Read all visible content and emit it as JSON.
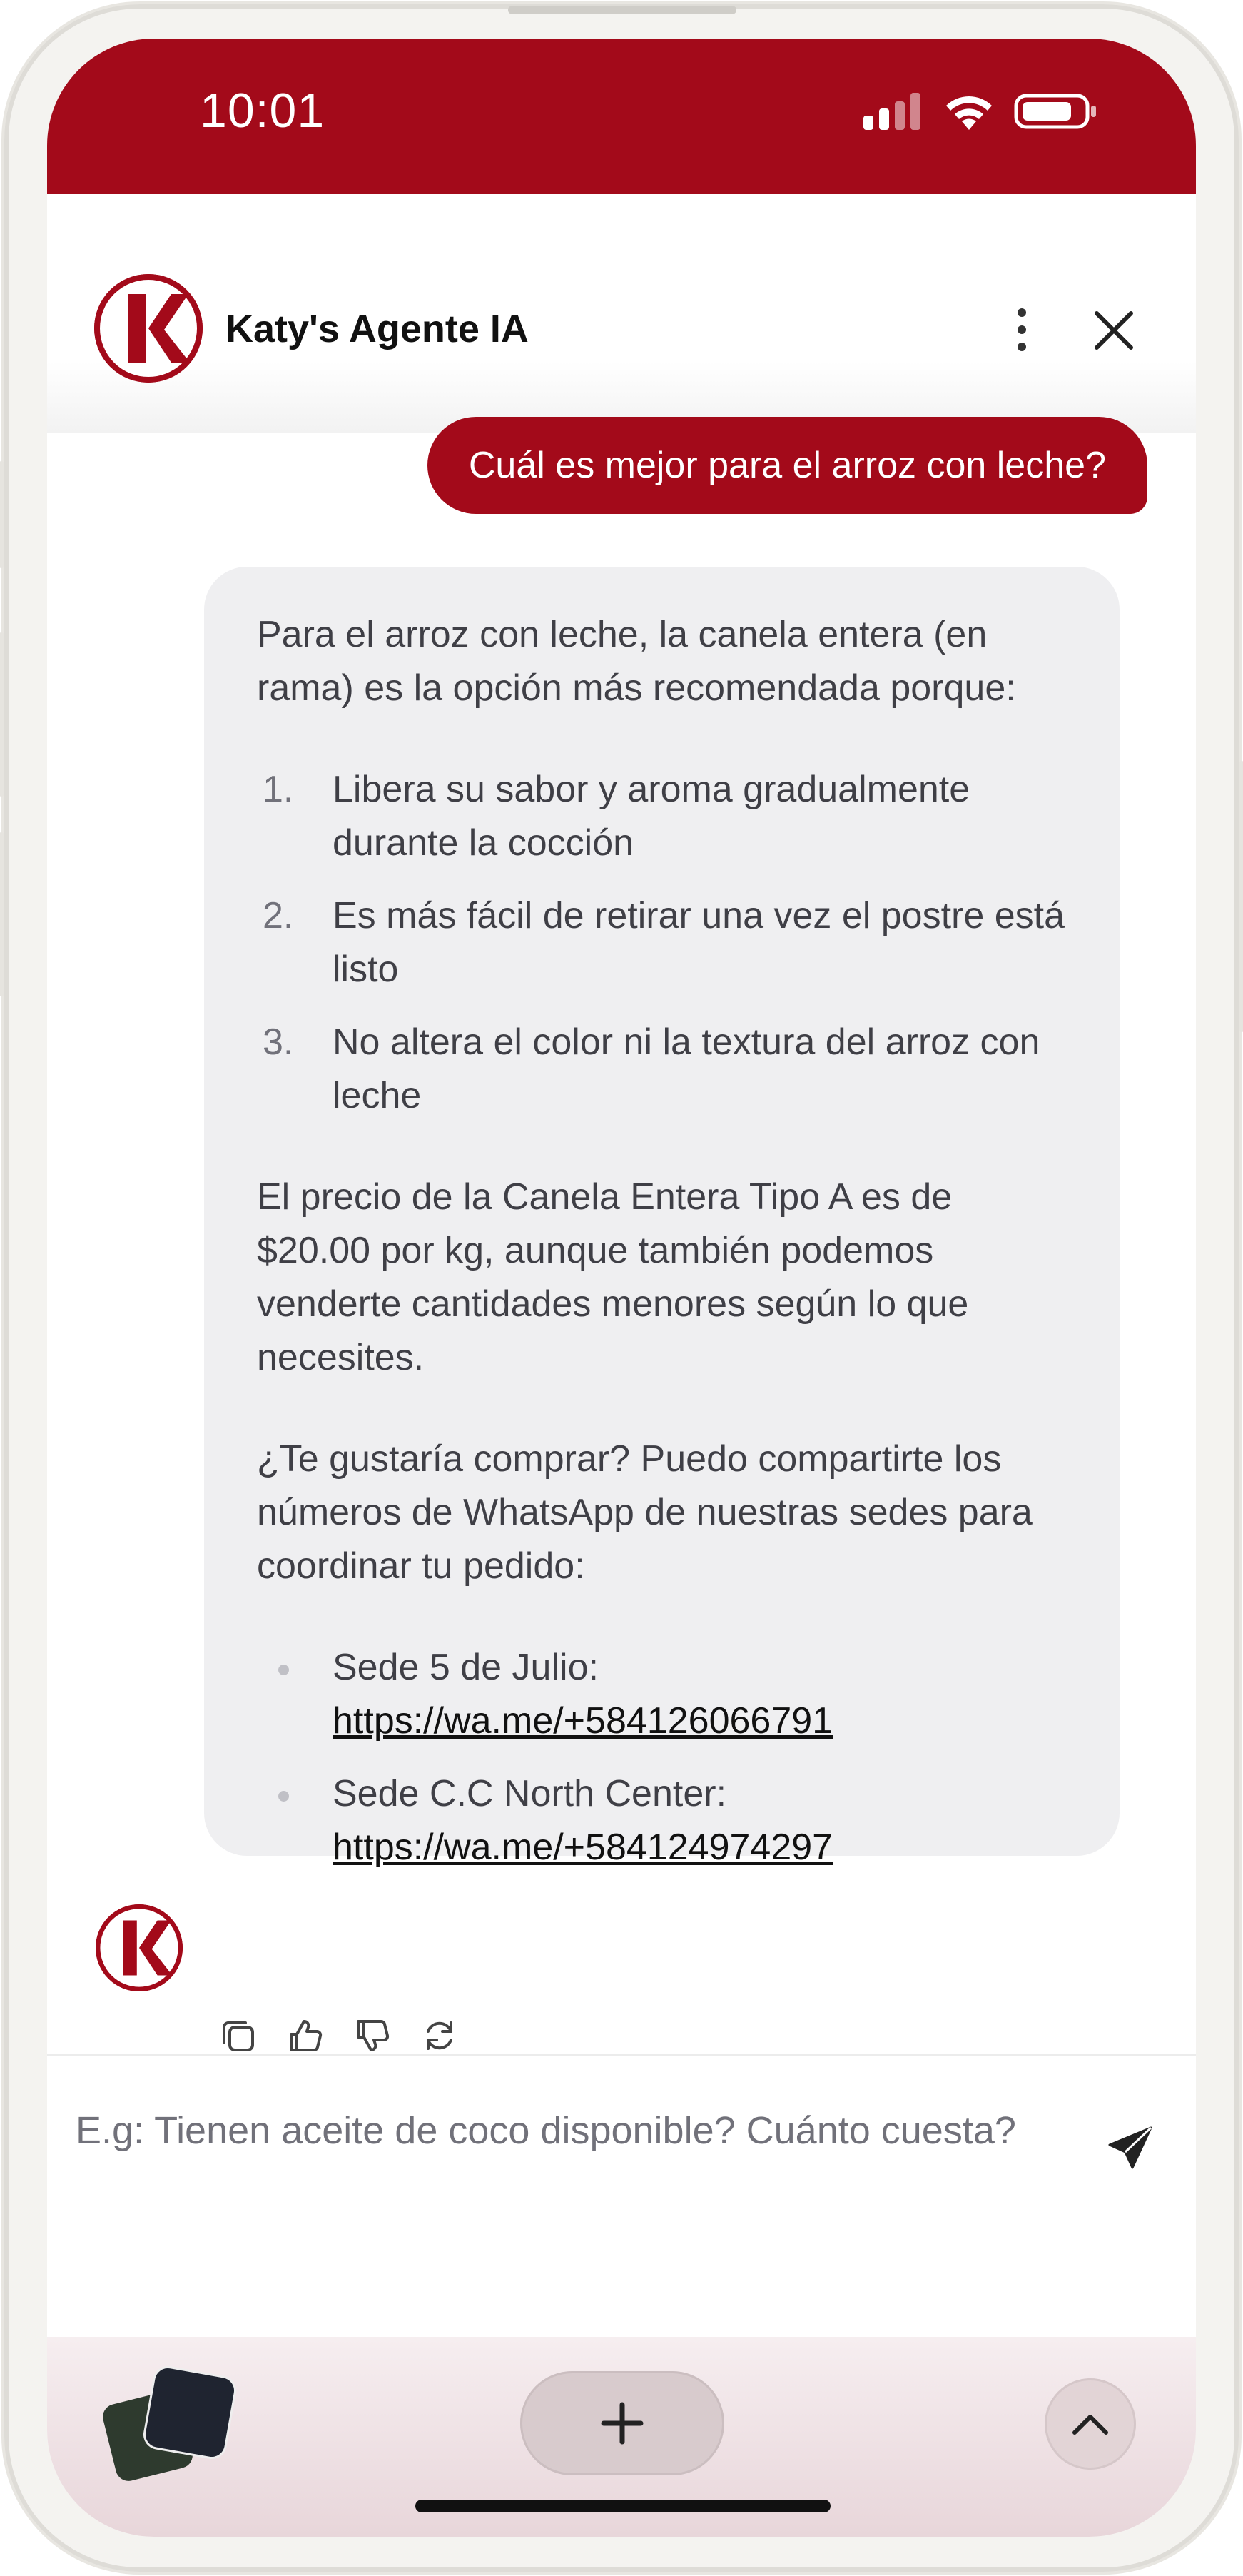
{
  "status_bar": {
    "time": "10:01"
  },
  "header": {
    "title": "Katy's Agente IA",
    "logo_letter": "K"
  },
  "chat": {
    "user_message": "Cuál es mejor para el arroz con leche?",
    "bot_message": {
      "intro": "Para el arroz con leche, la canela entera (en rama) es la opción más recomendada porque:",
      "reasons": [
        {
          "num": "1.",
          "text": "Libera su sabor y aroma gradualmente durante la cocción"
        },
        {
          "num": "2.",
          "text": "Es más fácil de retirar una vez el postre está listo"
        },
        {
          "num": "3.",
          "text": "No altera el color ni la textura del arroz con leche"
        }
      ],
      "price_text": "El precio de la Canela Entera Tipo A es de $20.00 por kg, aunque también podemos venderte cantidades menores según lo que necesites.",
      "question_text": "¿Te gustaría comprar? Puedo compartirte los números de WhatsApp de nuestras sedes para coordinar tu pedido:",
      "locations": [
        {
          "label": "Sede 5 de Julio:",
          "link": "https://wa.me/+584126066791"
        },
        {
          "label": "Sede C.C North Center:",
          "link": "https://wa.me/+584124974297"
        }
      ]
    },
    "actions": [
      "copy-icon",
      "thumbs-up-icon",
      "thumbs-down-icon",
      "refresh-icon"
    ]
  },
  "input": {
    "placeholder": "E.g: Tienen aceite de coco disponible? Cuánto cuesta?"
  },
  "colors": {
    "brand": "#a30a1a",
    "bubble": "#efeff1",
    "text": "#3f3f46"
  }
}
